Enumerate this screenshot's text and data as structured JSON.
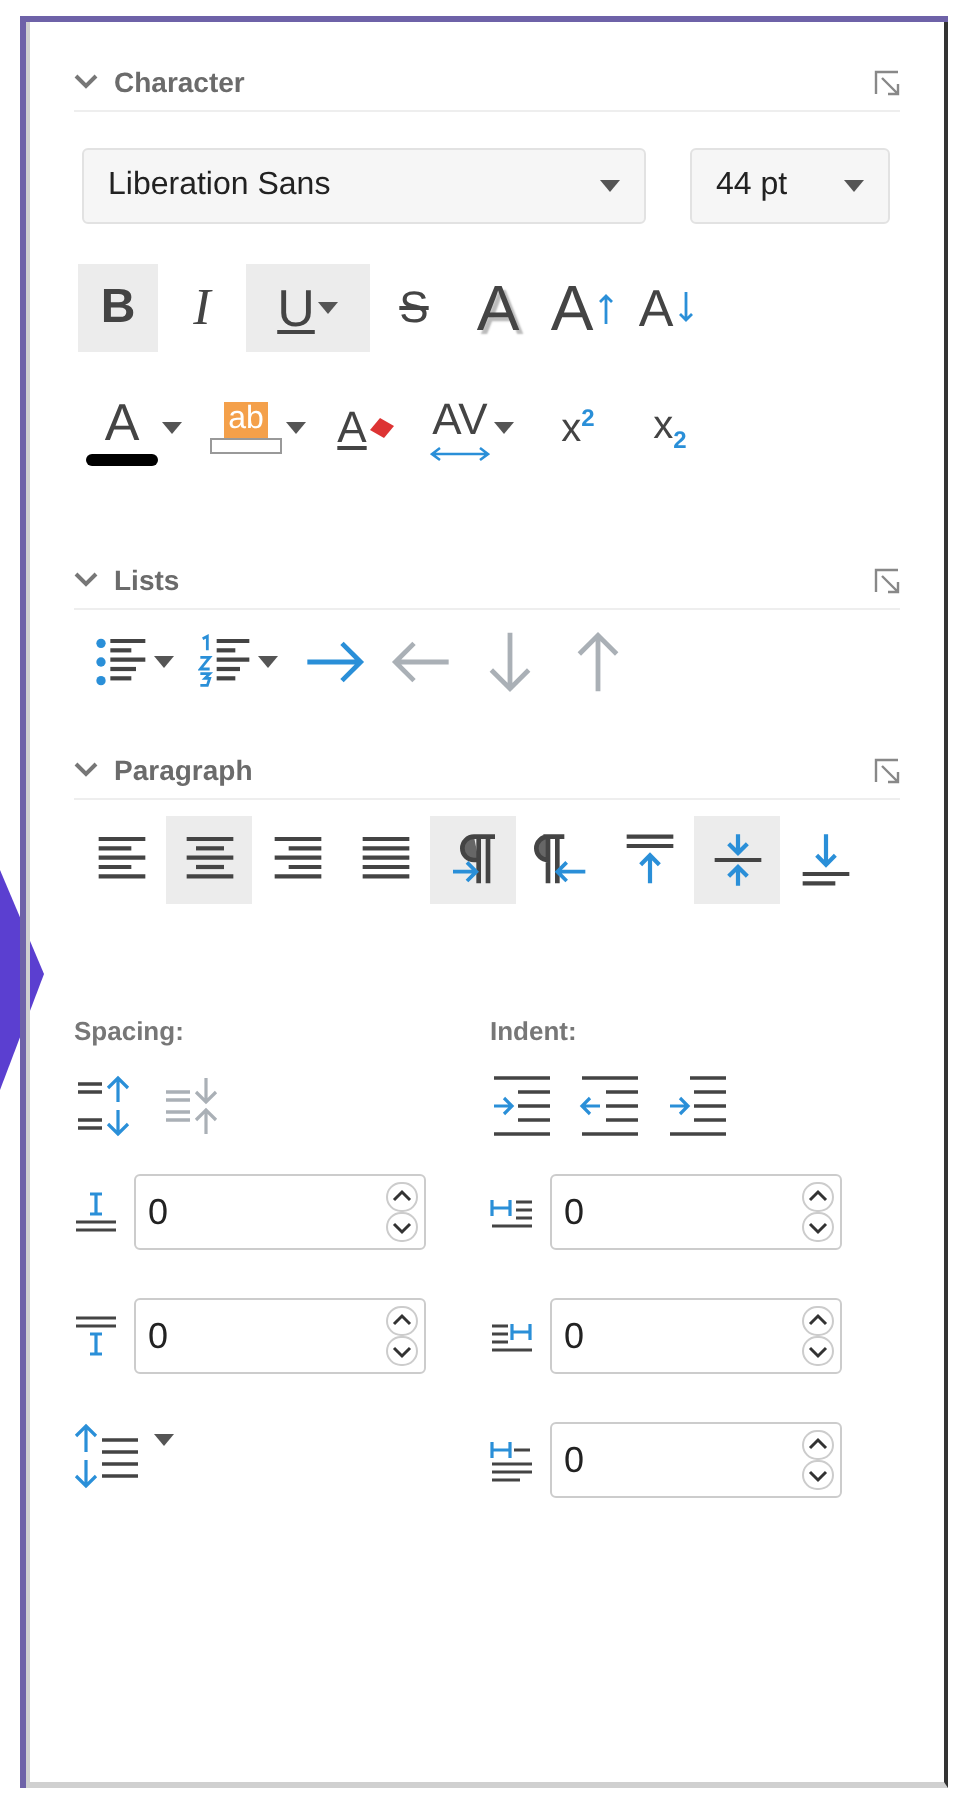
{
  "character": {
    "title": "Character",
    "expanded": true,
    "font": "Liberation Sans",
    "size": "44 pt",
    "row1": [
      {
        "kind": "bold",
        "glyph": "B",
        "selected": true
      },
      {
        "kind": "italic",
        "glyph": "I",
        "selected": false
      },
      {
        "kind": "underline",
        "glyph": "U",
        "selected": true
      },
      {
        "kind": "strikethrough",
        "glyph": "S",
        "selected": false
      },
      {
        "kind": "shadow",
        "glyph": "A",
        "selected": false
      },
      {
        "kind": "grow",
        "glyph": "A",
        "selected": false
      },
      {
        "kind": "shrink",
        "glyph": "A",
        "selected": false
      }
    ],
    "row2": [
      {
        "kind": "font_color",
        "glyph": "A"
      },
      {
        "kind": "highlight",
        "glyph": "ab"
      },
      {
        "kind": "clear",
        "glyph": "A"
      },
      {
        "kind": "spacing",
        "glyph": "AV"
      },
      {
        "kind": "superscript",
        "glyph": "x$^{2}$"
      },
      {
        "kind": "subscript",
        "glyph": "x$_{2}$"
      }
    ]
  },
  "lists": {
    "title": "Lists",
    "expanded": true,
    "buttons": [
      {
        "kind": "bullets",
        "disabled": false
      },
      {
        "kind": "numbering",
        "disabled": false
      },
      {
        "kind": "indent",
        "disabled": false
      },
      {
        "kind": "outdent",
        "disabled": true
      },
      {
        "kind": "down",
        "disabled": true
      },
      {
        "kind": "up",
        "disabled": true
      }
    ]
  },
  "paragraph": {
    "title": "Paragraph",
    "expanded": true,
    "buttons": [
      {
        "kind": "align_left",
        "selected": false
      },
      {
        "kind": "align_center",
        "selected": true
      },
      {
        "kind": "align_right",
        "selected": false
      },
      {
        "kind": "justify",
        "selected": false
      },
      {
        "kind": "ltr",
        "selected": true
      },
      {
        "kind": "rtl",
        "selected": false
      },
      {
        "kind": "top",
        "selected": false
      },
      {
        "kind": "center",
        "selected": true
      },
      {
        "kind": "bottom",
        "selected": false
      }
    ],
    "spacing": {
      "label": "Spacing:",
      "buttons": [
        {
          "kind": "increase",
          "disabled": false
        },
        {
          "kind": "decrease",
          "disabled": true
        }
      ],
      "fields": [
        {
          "kind": "above",
          "value": "0"
        },
        {
          "kind": "below",
          "value": "0"
        }
      ]
    },
    "indent": {
      "label": "Indent:",
      "buttons": [
        {
          "kind": "increase"
        },
        {
          "kind": "decrease"
        },
        {
          "kind": "hanging"
        }
      ],
      "fields": [
        {
          "kind": "before",
          "value": "0"
        },
        {
          "kind": "after",
          "value": "0"
        },
        {
          "kind": "first_line",
          "value": "0"
        }
      ]
    }
  }
}
